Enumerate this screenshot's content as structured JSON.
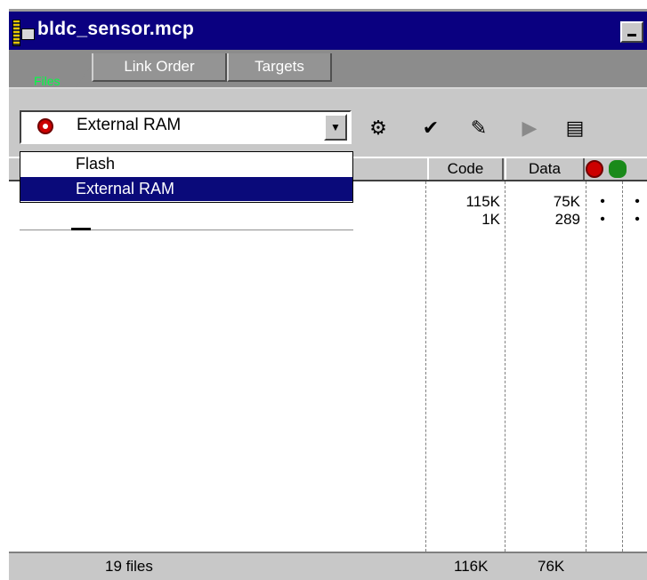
{
  "window": {
    "title": "bldc_sensor.mcp"
  },
  "tabs": [
    {
      "label": "Files",
      "active": true
    },
    {
      "label": "Link Order",
      "active": false
    },
    {
      "label": "Targets",
      "active": false
    }
  ],
  "toolbar": {
    "target_selected": "External RAM",
    "icons": [
      "settings-icon",
      "check-icon",
      "make-icon",
      "run-icon",
      "document-icon"
    ]
  },
  "dropdown": {
    "options": [
      "Flash",
      "External RAM"
    ],
    "selected": "External RAM"
  },
  "columns": {
    "code": "Code",
    "data": "Data"
  },
  "rows": [
    {
      "code": "115K",
      "data": "75K",
      "debug": "•",
      "touch": "•"
    },
    {
      "code": "1K",
      "data": "289",
      "debug": "•",
      "touch": "•"
    }
  ],
  "status": {
    "file_count": "19 files",
    "code_total": "116K",
    "data_total": "76K"
  },
  "colors": {
    "title_bar": "#0a0080",
    "selection": "#0a0a7a",
    "files_tab_text": "#00ff44"
  }
}
